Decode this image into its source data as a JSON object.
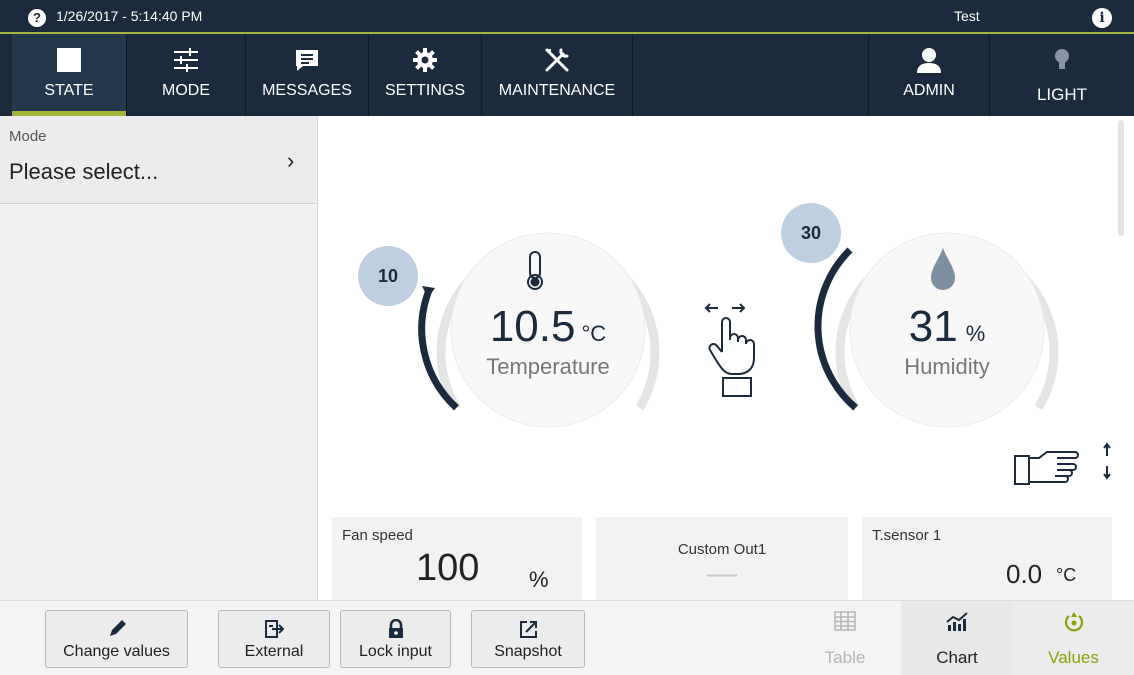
{
  "status_bar": {
    "datetime": "1/26/2017 - 5:14:40 PM",
    "user": "Test",
    "help_glyph": "?",
    "info_glyph": "i",
    "accent_color": "#a4b53c"
  },
  "nav": {
    "items": [
      {
        "label": "STATE",
        "icon": "square-icon",
        "active": true
      },
      {
        "label": "MODE",
        "icon": "sliders-icon"
      },
      {
        "label": "MESSAGES",
        "icon": "message-icon"
      },
      {
        "label": "SETTINGS",
        "icon": "gear-icon"
      },
      {
        "label": "MAINTENANCE",
        "icon": "tools-icon"
      },
      {
        "label": "ADMIN",
        "icon": "user-icon"
      },
      {
        "label": "LIGHT",
        "icon": "bulb-icon"
      }
    ]
  },
  "mode_panel": {
    "caption": "Mode",
    "value": "Please select...",
    "chevron": "›"
  },
  "gauges": [
    {
      "name": "temperature",
      "value": "10.5",
      "unit": "°C",
      "label": "Temperature",
      "setpoint": "10",
      "icon": "thermometer-icon"
    },
    {
      "name": "humidity",
      "value": "31",
      "unit": "%",
      "label": "Humidity",
      "setpoint": "30",
      "icon": "water-drop-icon"
    }
  ],
  "tiles": [
    {
      "caption": "Fan speed",
      "value": "100",
      "unit": "%"
    },
    {
      "caption": "Custom Out1",
      "value": "—",
      "unit": ""
    },
    {
      "caption": "T.sensor 1",
      "value": "0.0",
      "unit": "°C"
    }
  ],
  "toolbar": {
    "buttons": [
      {
        "label": "Change values",
        "icon": "pencil-icon"
      },
      {
        "label": "External",
        "icon": "external-icon"
      },
      {
        "label": "Lock input",
        "icon": "lock-icon"
      },
      {
        "label": "Snapshot",
        "icon": "snapshot-icon"
      }
    ],
    "tabs": [
      {
        "label": "Table",
        "icon": "table-icon",
        "state": "disabled"
      },
      {
        "label": "Chart",
        "icon": "chart-icon",
        "state": "normal"
      },
      {
        "label": "Values",
        "icon": "values-icon",
        "state": "selected"
      }
    ]
  },
  "colors": {
    "navy": "#1b2a3c",
    "gauge_track": "#e4e4e4",
    "setpoint_bubble": "#bfcfe2",
    "values_tab": "#8aa10c"
  }
}
